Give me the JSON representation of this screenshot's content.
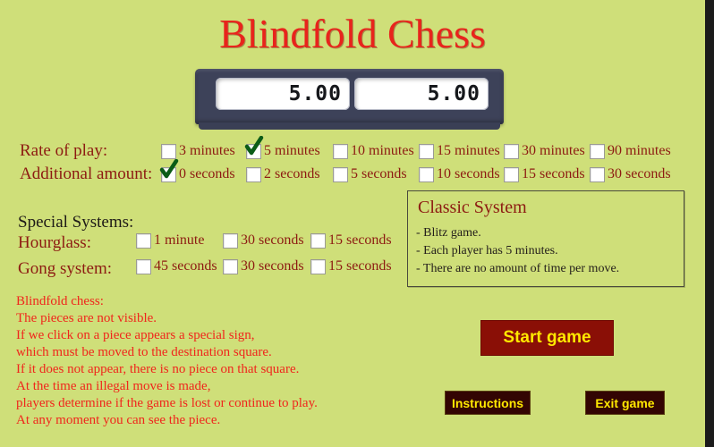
{
  "app": {
    "title": "Blindfold Chess",
    "background_color": "#cfdf79",
    "title_color": "#e8241c"
  },
  "clock": {
    "left_display": "5.00",
    "right_display": "5.00",
    "body_color": "#3d4259"
  },
  "rate_of_play": {
    "label": "Rate of play:",
    "options": [
      {
        "label": "3 minutes",
        "checked": false
      },
      {
        "label": "5 minutes",
        "checked": true
      },
      {
        "label": "10 minutes",
        "checked": false
      },
      {
        "label": "15 minutes",
        "checked": false
      },
      {
        "label": "30 minutes",
        "checked": false
      },
      {
        "label": "90 minutes",
        "checked": false
      }
    ]
  },
  "additional_amount": {
    "label": "Additional amount:",
    "options": [
      {
        "label": "0 seconds",
        "checked": true
      },
      {
        "label": "2 seconds",
        "checked": false
      },
      {
        "label": "5 seconds",
        "checked": false
      },
      {
        "label": "10 seconds",
        "checked": false
      },
      {
        "label": "15 seconds",
        "checked": false
      },
      {
        "label": "30 seconds",
        "checked": false
      }
    ]
  },
  "special_systems": {
    "label": "Special Systems:",
    "hourglass": {
      "label": "Hourglass:",
      "options": [
        {
          "label": "1 minute",
          "checked": false
        },
        {
          "label": "30 seconds",
          "checked": false
        },
        {
          "label": "15 seconds",
          "checked": false
        }
      ]
    },
    "gong": {
      "label": "Gong system:",
      "options": [
        {
          "label": "45 seconds",
          "checked": false
        },
        {
          "label": "30 seconds",
          "checked": false
        },
        {
          "label": "15 seconds",
          "checked": false
        }
      ]
    }
  },
  "info_panel": {
    "title": "Classic System",
    "lines": [
      "- Blitz game.",
      "- Each player has 5 minutes.",
      "- There are no amount of time per move."
    ]
  },
  "description": {
    "lines": [
      "Blindfold chess:",
      " The pieces are not visible.",
      " If we click on a piece appears a special sign,",
      "which must be moved to the destination square.",
      " If it does not appear, there is no piece on that square.",
      "At the time an illegal move is made,",
      " players determine if the game is lost or continue to play.",
      "At any moment you can see the piece."
    ],
    "color": "#f0261c"
  },
  "buttons": {
    "start": "Start game",
    "instructions": "Instructions",
    "exit": "Exit game",
    "start_bg": "#8a0f06",
    "small_bg": "#330503",
    "text_color": "#ffe800"
  }
}
